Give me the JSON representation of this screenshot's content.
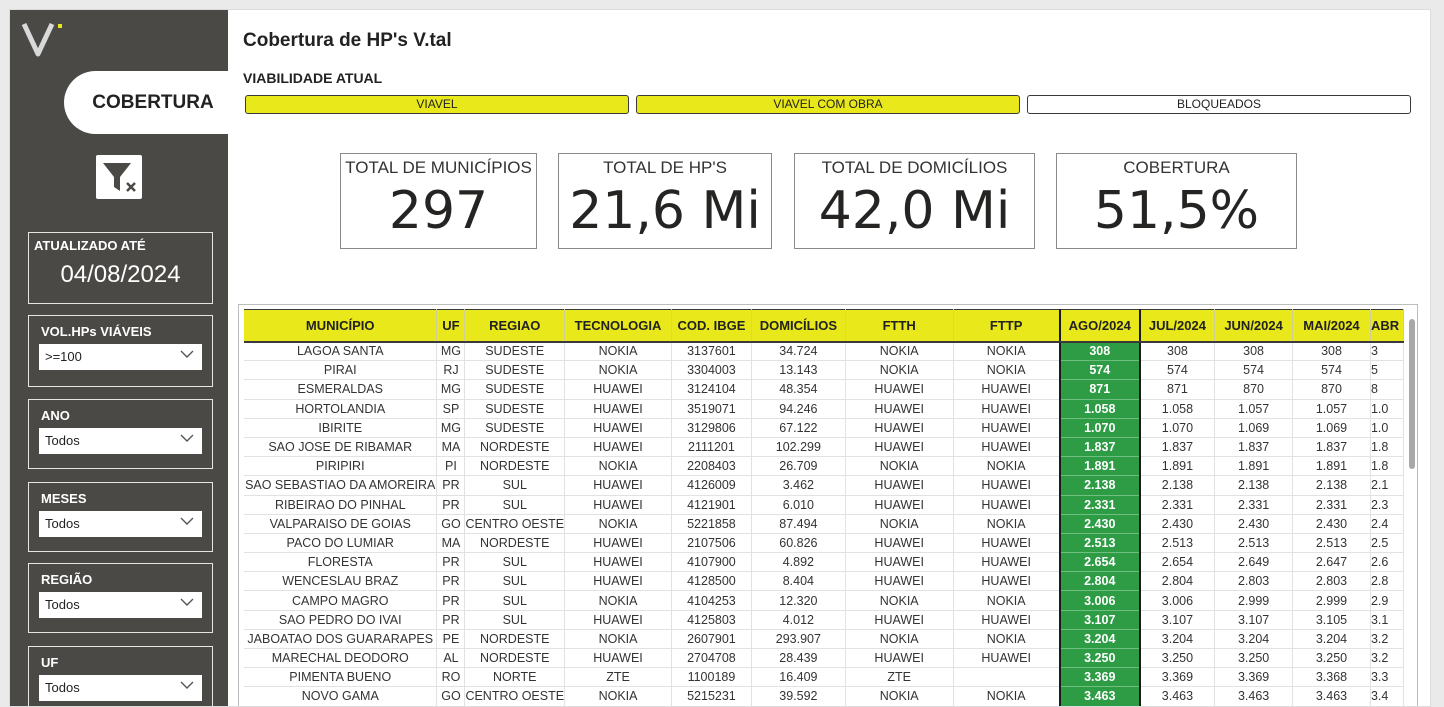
{
  "sidebar": {
    "nav_tab": "COBERTURA",
    "updated_label": "ATUALIZADO ATÉ",
    "updated_date": "04/08/2024",
    "filters": [
      {
        "label": "VOL.HPs VIÁVEIS",
        "value": ">=100"
      },
      {
        "label": "ANO",
        "value": "Todos"
      },
      {
        "label": "MESES",
        "value": "Todos"
      },
      {
        "label": "REGIÃO",
        "value": "Todos"
      },
      {
        "label": "UF",
        "value": "Todos"
      }
    ]
  },
  "header": {
    "title": "Cobertura de HP's V.tal",
    "subtitle": "VIABILIDADE ATUAL",
    "buttons": [
      "VIAVEL",
      "VIAVEL COM OBRA",
      "BLOQUEADOS"
    ]
  },
  "kpis": [
    {
      "label": "TOTAL DE MUNICÍPIOS",
      "value": "297"
    },
    {
      "label": "TOTAL DE HP'S",
      "value": "21,6 Mi"
    },
    {
      "label": "TOTAL DE DOMICÍLIOS",
      "value": "42,0 Mi"
    },
    {
      "label": "COBERTURA",
      "value": "51,5%"
    }
  ],
  "colors": {
    "accent_yellow": "#e8e81a",
    "highlight_green": "#2e9b45",
    "sidebar_bg": "#4a4945"
  },
  "table": {
    "columns": [
      "MUNICÍPIO",
      "UF",
      "REGIAO",
      "TECNOLOGIA",
      "COD. IBGE",
      "DOMICÍLIOS",
      "FTTH",
      "FTTP",
      "AGO/2024",
      "JUL/2024",
      "JUN/2024",
      "MAI/2024",
      "ABR"
    ],
    "rows": [
      [
        "LAGOA SANTA",
        "MG",
        "SUDESTE",
        "NOKIA",
        "3137601",
        "34.724",
        "NOKIA",
        "NOKIA",
        "308",
        "308",
        "308",
        "308",
        "3"
      ],
      [
        "PIRAI",
        "RJ",
        "SUDESTE",
        "NOKIA",
        "3304003",
        "13.143",
        "NOKIA",
        "NOKIA",
        "574",
        "574",
        "574",
        "574",
        "5"
      ],
      [
        "ESMERALDAS",
        "MG",
        "SUDESTE",
        "HUAWEI",
        "3124104",
        "48.354",
        "HUAWEI",
        "HUAWEI",
        "871",
        "871",
        "870",
        "870",
        "8"
      ],
      [
        "HORTOLANDIA",
        "SP",
        "SUDESTE",
        "HUAWEI",
        "3519071",
        "94.246",
        "HUAWEI",
        "HUAWEI",
        "1.058",
        "1.058",
        "1.057",
        "1.057",
        "1.0"
      ],
      [
        "IBIRITE",
        "MG",
        "SUDESTE",
        "HUAWEI",
        "3129806",
        "67.122",
        "HUAWEI",
        "HUAWEI",
        "1.070",
        "1.070",
        "1.069",
        "1.069",
        "1.0"
      ],
      [
        "SAO JOSE DE RIBAMAR",
        "MA",
        "NORDESTE",
        "HUAWEI",
        "2111201",
        "102.299",
        "HUAWEI",
        "HUAWEI",
        "1.837",
        "1.837",
        "1.837",
        "1.837",
        "1.8"
      ],
      [
        "PIRIPIRI",
        "PI",
        "NORDESTE",
        "NOKIA",
        "2208403",
        "26.709",
        "NOKIA",
        "NOKIA",
        "1.891",
        "1.891",
        "1.891",
        "1.891",
        "1.8"
      ],
      [
        "SAO SEBASTIAO DA AMOREIRA",
        "PR",
        "SUL",
        "HUAWEI",
        "4126009",
        "3.462",
        "HUAWEI",
        "HUAWEI",
        "2.138",
        "2.138",
        "2.138",
        "2.138",
        "2.1"
      ],
      [
        "RIBEIRAO DO PINHAL",
        "PR",
        "SUL",
        "HUAWEI",
        "4121901",
        "6.010",
        "HUAWEI",
        "HUAWEI",
        "2.331",
        "2.331",
        "2.331",
        "2.331",
        "2.3"
      ],
      [
        "VALPARAISO DE GOIAS",
        "GO",
        "CENTRO OESTE",
        "NOKIA",
        "5221858",
        "87.494",
        "NOKIA",
        "NOKIA",
        "2.430",
        "2.430",
        "2.430",
        "2.430",
        "2.4"
      ],
      [
        "PACO DO LUMIAR",
        "MA",
        "NORDESTE",
        "HUAWEI",
        "2107506",
        "60.826",
        "HUAWEI",
        "HUAWEI",
        "2.513",
        "2.513",
        "2.513",
        "2.513",
        "2.5"
      ],
      [
        "FLORESTA",
        "PR",
        "SUL",
        "HUAWEI",
        "4107900",
        "4.892",
        "HUAWEI",
        "HUAWEI",
        "2.654",
        "2.654",
        "2.649",
        "2.647",
        "2.6"
      ],
      [
        "WENCESLAU BRAZ",
        "PR",
        "SUL",
        "HUAWEI",
        "4128500",
        "8.404",
        "HUAWEI",
        "HUAWEI",
        "2.804",
        "2.804",
        "2.803",
        "2.803",
        "2.8"
      ],
      [
        "CAMPO MAGRO",
        "PR",
        "SUL",
        "NOKIA",
        "4104253",
        "12.320",
        "NOKIA",
        "NOKIA",
        "3.006",
        "3.006",
        "2.999",
        "2.999",
        "2.9"
      ],
      [
        "SAO PEDRO DO IVAI",
        "PR",
        "SUL",
        "HUAWEI",
        "4125803",
        "4.012",
        "HUAWEI",
        "HUAWEI",
        "3.107",
        "3.107",
        "3.107",
        "3.105",
        "3.1"
      ],
      [
        "JABOATAO DOS GUARARAPES",
        "PE",
        "NORDESTE",
        "NOKIA",
        "2607901",
        "293.907",
        "NOKIA",
        "NOKIA",
        "3.204",
        "3.204",
        "3.204",
        "3.204",
        "3.2"
      ],
      [
        "MARECHAL DEODORO",
        "AL",
        "NORDESTE",
        "HUAWEI",
        "2704708",
        "28.439",
        "HUAWEI",
        "HUAWEI",
        "3.250",
        "3.250",
        "3.250",
        "3.250",
        "3.2"
      ],
      [
        "PIMENTA BUENO",
        "RO",
        "NORTE",
        "ZTE",
        "1100189",
        "16.409",
        "ZTE",
        "",
        "3.369",
        "3.369",
        "3.369",
        "3.368",
        "3.3"
      ],
      [
        "NOVO GAMA",
        "GO",
        "CENTRO OESTE",
        "NOKIA",
        "5215231",
        "39.592",
        "NOKIA",
        "NOKIA",
        "3.463",
        "3.463",
        "3.463",
        "3.463",
        "3.4"
      ]
    ]
  }
}
